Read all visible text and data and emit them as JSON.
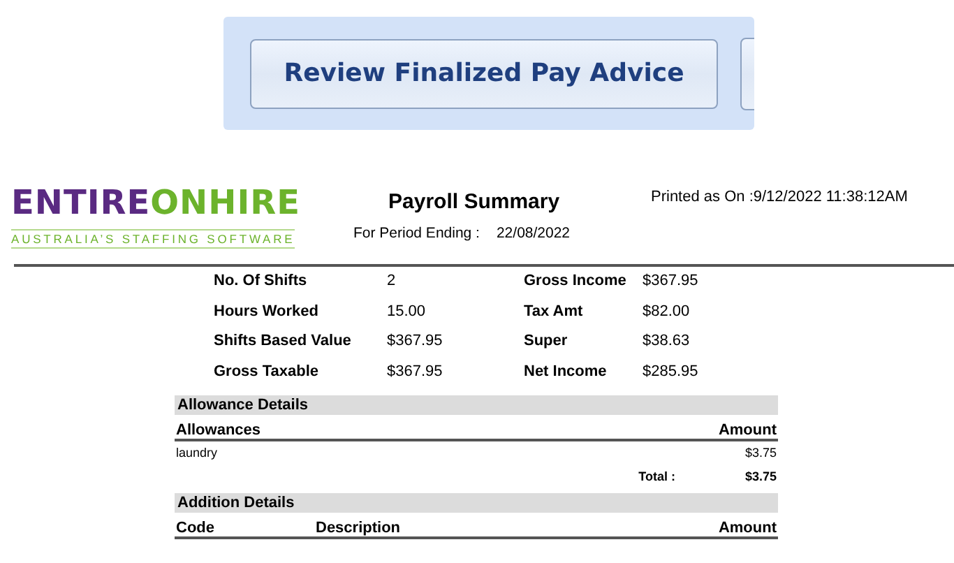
{
  "toolbar": {
    "buttons": [
      {
        "label": "Review Finalized Pay Advice"
      }
    ]
  },
  "report": {
    "logo": {
      "primary": "ENTIRE",
      "secondary": "ONHIRE",
      "tagline": "AUSTRALIA’S STAFFING SOFTWARE"
    },
    "title": "Payroll Summary",
    "printed": "Printed as On :9/12/2022 11:38:12AM",
    "period_label": "For Period Ending :",
    "period_value": "22/08/2022",
    "summary": [
      {
        "label": "No. Of Shifts",
        "value": "2",
        "label_2": "Gross Income",
        "value_2": "$367.95"
      },
      {
        "label": "Hours Worked",
        "value": "15.00",
        "label_2": "Tax Amt",
        "value_2": "$82.00"
      },
      {
        "label": "Shifts Based Value",
        "value": "$367.95",
        "label_2": "Super",
        "value_2": "$38.63"
      },
      {
        "label": "Gross Taxable",
        "value": "$367.95",
        "label_2": "Net Income",
        "value_2": "$285.95"
      }
    ],
    "allowance": {
      "title": "Allowance Details",
      "columns": [
        "Allowances",
        "Amount"
      ],
      "rows": [
        [
          "laundry",
          "$3.75"
        ]
      ],
      "total_label": "Total :",
      "total_value": "$3.75"
    },
    "addition": {
      "title": "Addition Details",
      "columns": [
        "Code",
        "Description",
        "Amount"
      ]
    }
  }
}
